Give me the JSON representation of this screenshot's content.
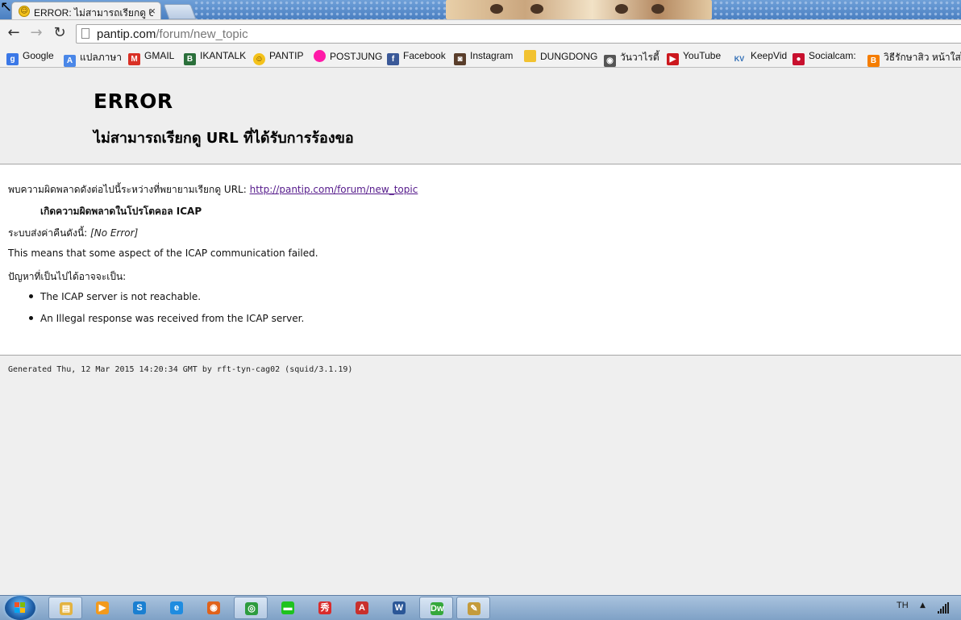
{
  "browser": {
    "tab": {
      "title": "ERROR: ไม่สามารถเรียกดู URL ที่ได้รับการร้องขอ",
      "close": "×"
    },
    "nav": {
      "back": "←",
      "forward": "→",
      "reload": "↻"
    },
    "address": {
      "domain": "pantip.com",
      "path": "/forum/new_topic"
    }
  },
  "bookmarks": [
    {
      "label": "Google",
      "icon": "google-icon",
      "color": "#3b78e7",
      "glyph": "g"
    },
    {
      "label": "แปลภาษา",
      "icon": "translate-icon",
      "color": "#4a87e8",
      "glyph": "A"
    },
    {
      "label": "GMAIL",
      "icon": "gmail-icon",
      "color": "#d93025",
      "glyph": "M"
    },
    {
      "label": "IKANTALK",
      "icon": "ikantalk-icon",
      "color": "#2a6f3a",
      "glyph": "B"
    },
    {
      "label": "PANTIP",
      "icon": "pantip-icon",
      "color": "#f4c21b",
      "glyph": "☺"
    },
    {
      "label": "POSTJUNG",
      "icon": "postjung-icon",
      "color": "#ff1aa8",
      "glyph": ""
    },
    {
      "label": "Facebook",
      "icon": "facebook-icon",
      "color": "#3b5998",
      "glyph": "f"
    },
    {
      "label": "Instagram",
      "icon": "instagram-icon",
      "color": "#5a3e2b",
      "glyph": "◙"
    },
    {
      "label": "DUNGDONG",
      "icon": "dungdong-icon",
      "color": "#f2c230",
      "glyph": ""
    },
    {
      "label": "วันวาไรตี้",
      "icon": "eye-icon",
      "color": "#555555",
      "glyph": "◉"
    },
    {
      "label": "YouTube",
      "icon": "youtube-icon",
      "color": "#cc181e",
      "glyph": "▶"
    },
    {
      "label": "KeepVid",
      "icon": "keepvid-icon",
      "color": "#2f6db5",
      "glyph": "KV"
    },
    {
      "label": "Socialcam:",
      "icon": "socialcam-icon",
      "color": "#c8102e",
      "glyph": "●"
    },
    {
      "label": "วิธีรักษาสิว หน้าใสไร้",
      "icon": "blogger-icon",
      "color": "#f57d00",
      "glyph": "B"
    }
  ],
  "page": {
    "heading": "ERROR",
    "subheading": "ไม่สามารถเรียกดู URL ที่ได้รับการร้องขอ",
    "line1_prefix": "พบความผิดพลาดดังต่อไปนี้ระหว่างที่พยายามเรียกดู URL: ",
    "line1_link": "http://pantip.com/forum/new_topic",
    "line2": "เกิดความผิดพลาดในโปรโตคอล ICAP",
    "line3_prefix": "ระบบส่งค่าคืนดังนี้: ",
    "line3_value": "[No Error]",
    "line4": "This means that some aspect of the ICAP communication failed.",
    "line5": "ปัญหาที่เป็นไปได้อาจจะเป็น:",
    "bullets": [
      "The ICAP server is not reachable.",
      "An Illegal response was received from the ICAP server."
    ],
    "footer": "Generated Thu, 12 Mar 2015 14:20:34 GMT by rft-tyn-cag02 (squid/3.1.19)"
  },
  "taskbar": {
    "apps": [
      {
        "name": "explorer-icon",
        "color": "#e3b341",
        "glyph": "▤",
        "open": true
      },
      {
        "name": "media-player-icon",
        "color": "#f29a1d",
        "glyph": "▶",
        "open": false
      },
      {
        "name": "skype-icon",
        "color": "#1a7fd1",
        "glyph": "S",
        "open": false
      },
      {
        "name": "internet-explorer-icon",
        "color": "#1f8ce0",
        "glyph": "e",
        "open": false
      },
      {
        "name": "firefox-icon",
        "color": "#e0621b",
        "glyph": "◉",
        "open": false
      },
      {
        "name": "chrome-icon",
        "color": "#2d9c3f",
        "glyph": "◎",
        "open": true
      },
      {
        "name": "line-icon",
        "color": "#1ec31e",
        "glyph": "▬",
        "open": false
      },
      {
        "name": "photo-app-icon",
        "color": "#d92c2c",
        "glyph": "秀",
        "open": false
      },
      {
        "name": "acrobat-icon",
        "color": "#c9302c",
        "glyph": "A",
        "open": false
      },
      {
        "name": "word-icon",
        "color": "#2b5797",
        "glyph": "W",
        "open": false
      },
      {
        "name": "dreamweaver-icon",
        "color": "#35a83b",
        "glyph": "Dw",
        "open": true
      },
      {
        "name": "paint-icon",
        "color": "#c49b3c",
        "glyph": "✎",
        "open": true
      }
    ],
    "language": "TH",
    "tray_arrow": "▲"
  }
}
